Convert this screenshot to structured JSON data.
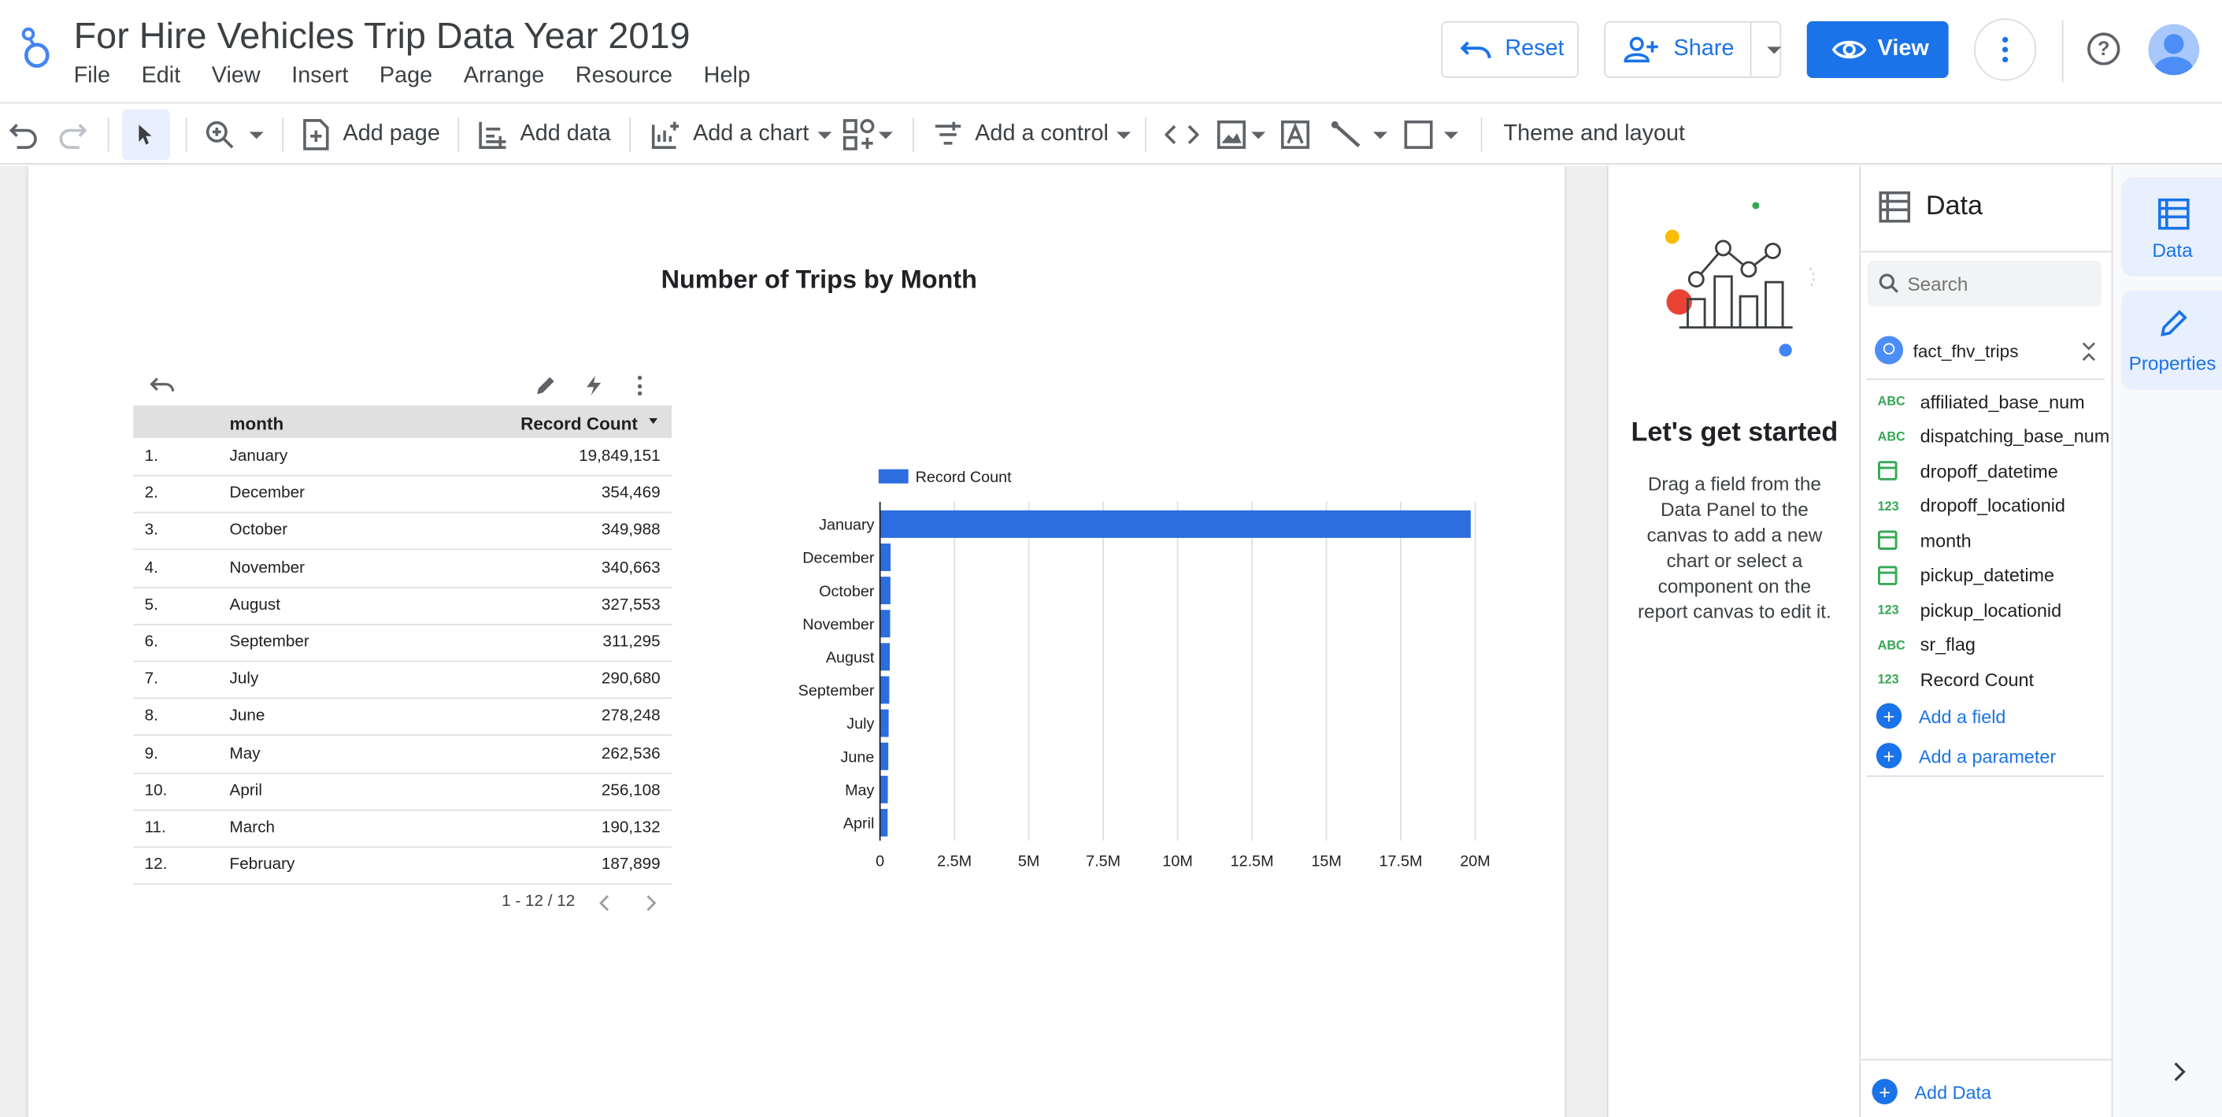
{
  "header": {
    "title": "For Hire Vehicles Trip Data Year 2019",
    "menu": [
      "File",
      "Edit",
      "View",
      "Insert",
      "Page",
      "Arrange",
      "Resource",
      "Help"
    ],
    "reset_label": "Reset",
    "share_label": "Share",
    "view_label": "View"
  },
  "toolbar": {
    "add_page": "Add page",
    "add_data": "Add data",
    "add_chart": "Add a chart",
    "add_control": "Add a control",
    "theme_layout": "Theme and layout"
  },
  "report": {
    "title": "Number of Trips by Month",
    "table": {
      "columns": [
        "month",
        "Record Count"
      ],
      "rows": [
        {
          "n": "1.",
          "month": "January",
          "count": "19,849,151"
        },
        {
          "n": "2.",
          "month": "December",
          "count": "354,469"
        },
        {
          "n": "3.",
          "month": "October",
          "count": "349,988"
        },
        {
          "n": "4.",
          "month": "November",
          "count": "340,663"
        },
        {
          "n": "5.",
          "month": "August",
          "count": "327,553"
        },
        {
          "n": "6.",
          "month": "September",
          "count": "311,295"
        },
        {
          "n": "7.",
          "month": "July",
          "count": "290,680"
        },
        {
          "n": "8.",
          "month": "June",
          "count": "278,248"
        },
        {
          "n": "9.",
          "month": "May",
          "count": "262,536"
        },
        {
          "n": "10.",
          "month": "April",
          "count": "256,108"
        },
        {
          "n": "11.",
          "month": "March",
          "count": "190,132"
        },
        {
          "n": "12.",
          "month": "February",
          "count": "187,899"
        }
      ],
      "pagination": "1 - 12 / 12"
    }
  },
  "chart_data": {
    "type": "bar",
    "orientation": "horizontal",
    "legend": "Record Count",
    "series_color": "#2c6ddf",
    "categories": [
      "January",
      "December",
      "October",
      "November",
      "August",
      "September",
      "July",
      "June",
      "May",
      "April"
    ],
    "values": [
      19849151,
      354469,
      349988,
      340663,
      327553,
      311295,
      290680,
      278248,
      262536,
      256108
    ],
    "xlim": [
      0,
      20000000
    ],
    "xticks": [
      "0",
      "2.5M",
      "5M",
      "7.5M",
      "10M",
      "12.5M",
      "15M",
      "17.5M",
      "20M"
    ],
    "grid": true
  },
  "get_started": {
    "heading": "Let's get started",
    "body": "Drag a field from the Data Panel to the canvas to add a new chart or select a component on the report canvas to edit it."
  },
  "data_panel": {
    "title": "Data",
    "search_placeholder": "Search",
    "source": "fact_fhv_trips",
    "fields": [
      {
        "type": "ABC",
        "name": "affiliated_base_num"
      },
      {
        "type": "ABC",
        "name": "dispatching_base_num"
      },
      {
        "type": "date",
        "name": "dropoff_datetime"
      },
      {
        "type": "123",
        "name": "dropoff_locationid"
      },
      {
        "type": "date",
        "name": "month"
      },
      {
        "type": "date",
        "name": "pickup_datetime"
      },
      {
        "type": "123",
        "name": "pickup_locationid"
      },
      {
        "type": "ABC",
        "name": "sr_flag"
      },
      {
        "type": "123",
        "name": "Record Count"
      }
    ],
    "add_field": "Add a field",
    "add_parameter": "Add a parameter",
    "add_data": "Add Data"
  },
  "sidebar": {
    "data_tab": "Data",
    "properties_tab": "Properties"
  },
  "colors": {
    "accent": "#1a73e8",
    "bar": "#2c6ddf"
  }
}
